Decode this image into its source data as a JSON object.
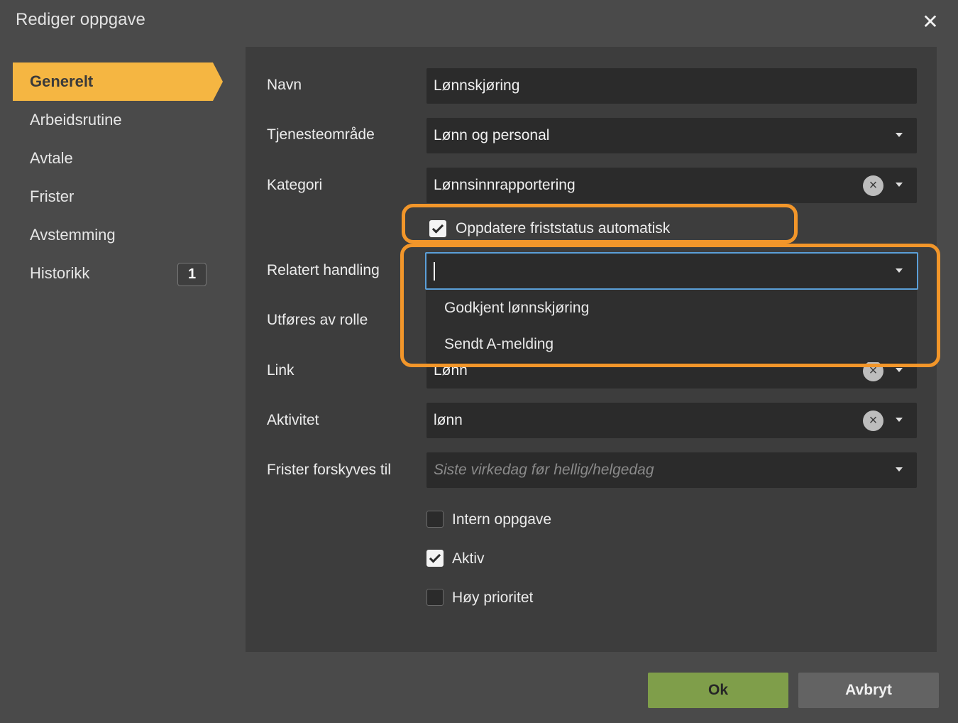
{
  "dialog": {
    "title": "Rediger oppgave"
  },
  "sidebar": {
    "items": [
      {
        "label": "Generelt"
      },
      {
        "label": "Arbeidsrutine"
      },
      {
        "label": "Avtale"
      },
      {
        "label": "Frister"
      },
      {
        "label": "Avstemming"
      },
      {
        "label": "Historikk",
        "badge": "1"
      }
    ],
    "active_index": 0
  },
  "form": {
    "navn": {
      "label": "Navn",
      "value": "Lønnskjøring"
    },
    "tjenesteomrade": {
      "label": "Tjenesteområde",
      "value": "Lønn og personal"
    },
    "kategori": {
      "label": "Kategori",
      "value": "Lønnsinnrapportering"
    },
    "auto_status": {
      "label": "Oppdatere friststatus automatisk",
      "checked": true
    },
    "relatert_handling": {
      "label": "Relatert handling",
      "value": "",
      "options": [
        "Godkjent lønnskjøring",
        "Sendt A-melding"
      ]
    },
    "utfores_av_rolle": {
      "label": "Utføres av rolle"
    },
    "link": {
      "label": "Link",
      "value": "Lønn"
    },
    "aktivitet": {
      "label": "Aktivitet",
      "value": "lønn"
    },
    "frister_forskyves": {
      "label": "Frister forskyves til",
      "placeholder": "Siste virkedag før hellig/helgedag"
    },
    "intern_oppgave": {
      "label": "Intern oppgave",
      "checked": false
    },
    "aktiv": {
      "label": "Aktiv",
      "checked": true
    },
    "hoy_prioritet": {
      "label": "Høy prioritet",
      "checked": false
    }
  },
  "buttons": {
    "ok": "Ok",
    "cancel": "Avbryt"
  },
  "colors": {
    "accent": "#f5b642",
    "highlight": "#f2962a",
    "ok": "#7f9e4a",
    "focus": "#5b9fd8"
  }
}
